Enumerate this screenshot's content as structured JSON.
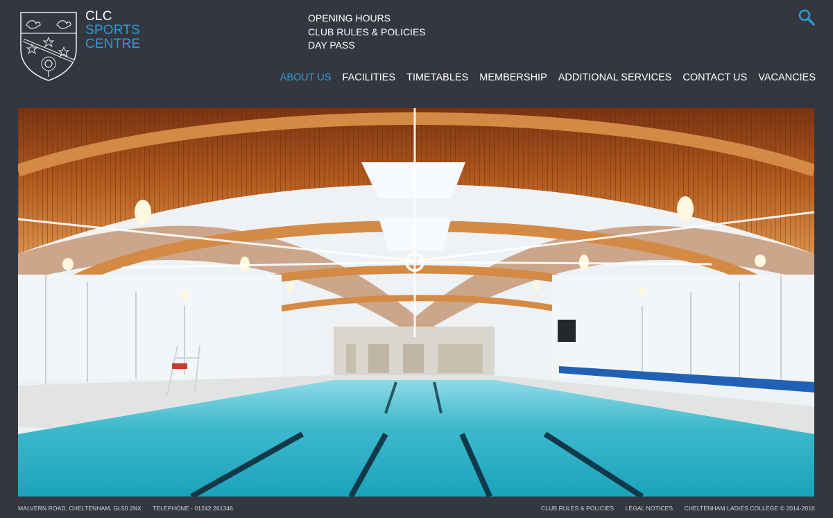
{
  "brand": {
    "line1": "CLC",
    "line2": "SPORTS",
    "line3": "CENTRE"
  },
  "top_links": [
    "OPENING HOURS",
    "CLUB RULES & POLICIES",
    "DAY PASS"
  ],
  "nav": [
    {
      "label": "ABOUT US",
      "active": true
    },
    {
      "label": "FACILITIES"
    },
    {
      "label": "TIMETABLES"
    },
    {
      "label": "MEMBERSHIP"
    },
    {
      "label": "ADDITIONAL SERVICES"
    },
    {
      "label": "CONTACT US"
    },
    {
      "label": "VACANCIES"
    }
  ],
  "footer": {
    "address": "MALVERN ROAD, CHELTENHAM, GL50 2NX",
    "telephone": "TELEPHONE - 01242 261346",
    "links": [
      "CLUB RULES & POLICIES",
      "LEGAL NOTICES"
    ],
    "copyright": "CHELTENHAM LADIES COLLEGE © 2014-2016"
  },
  "icons": {
    "logo": "school-crest-icon",
    "search": "search-icon"
  },
  "colors": {
    "background": "#34373f",
    "accent": "#2f9ad6",
    "text": "#ffffff"
  }
}
